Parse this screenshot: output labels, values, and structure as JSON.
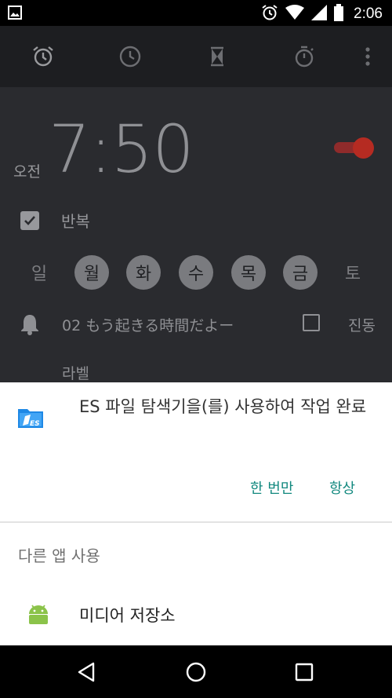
{
  "status_bar": {
    "time": "2:06",
    "icons": [
      "image-icon",
      "alarm-icon",
      "wifi-icon",
      "signal-icon",
      "battery-icon"
    ]
  },
  "toolbar": {
    "tabs": [
      "alarm-tab",
      "clock-tab",
      "timer-tab",
      "stopwatch-tab",
      "overflow-menu"
    ]
  },
  "alarm": {
    "ampm": "오전",
    "time": "7:50",
    "enabled": true,
    "repeat_label": "반복",
    "repeat_checked": true,
    "days": [
      {
        "label": "일",
        "on": false
      },
      {
        "label": "월",
        "on": true
      },
      {
        "label": "화",
        "on": true
      },
      {
        "label": "수",
        "on": true
      },
      {
        "label": "목",
        "on": true
      },
      {
        "label": "금",
        "on": true
      },
      {
        "label": "토",
        "on": false
      }
    ],
    "ringtone": "02 もう起きる時間だよー",
    "vibrate_label": "진동",
    "vibrate_checked": false,
    "label_text": "라벨"
  },
  "chooser": {
    "title": "ES 파일 탐색기을(를) 사용하여 작업 완료",
    "just_once": "한 번만",
    "always": "항상",
    "other_apps_title": "다른 앱 사용",
    "apps": [
      {
        "name": "미디어 저장소",
        "icon": "android-icon"
      }
    ]
  },
  "colors": {
    "accent": "#13897f",
    "toggle_on": "#b52b22",
    "dim_background": "#2a2b2f"
  }
}
